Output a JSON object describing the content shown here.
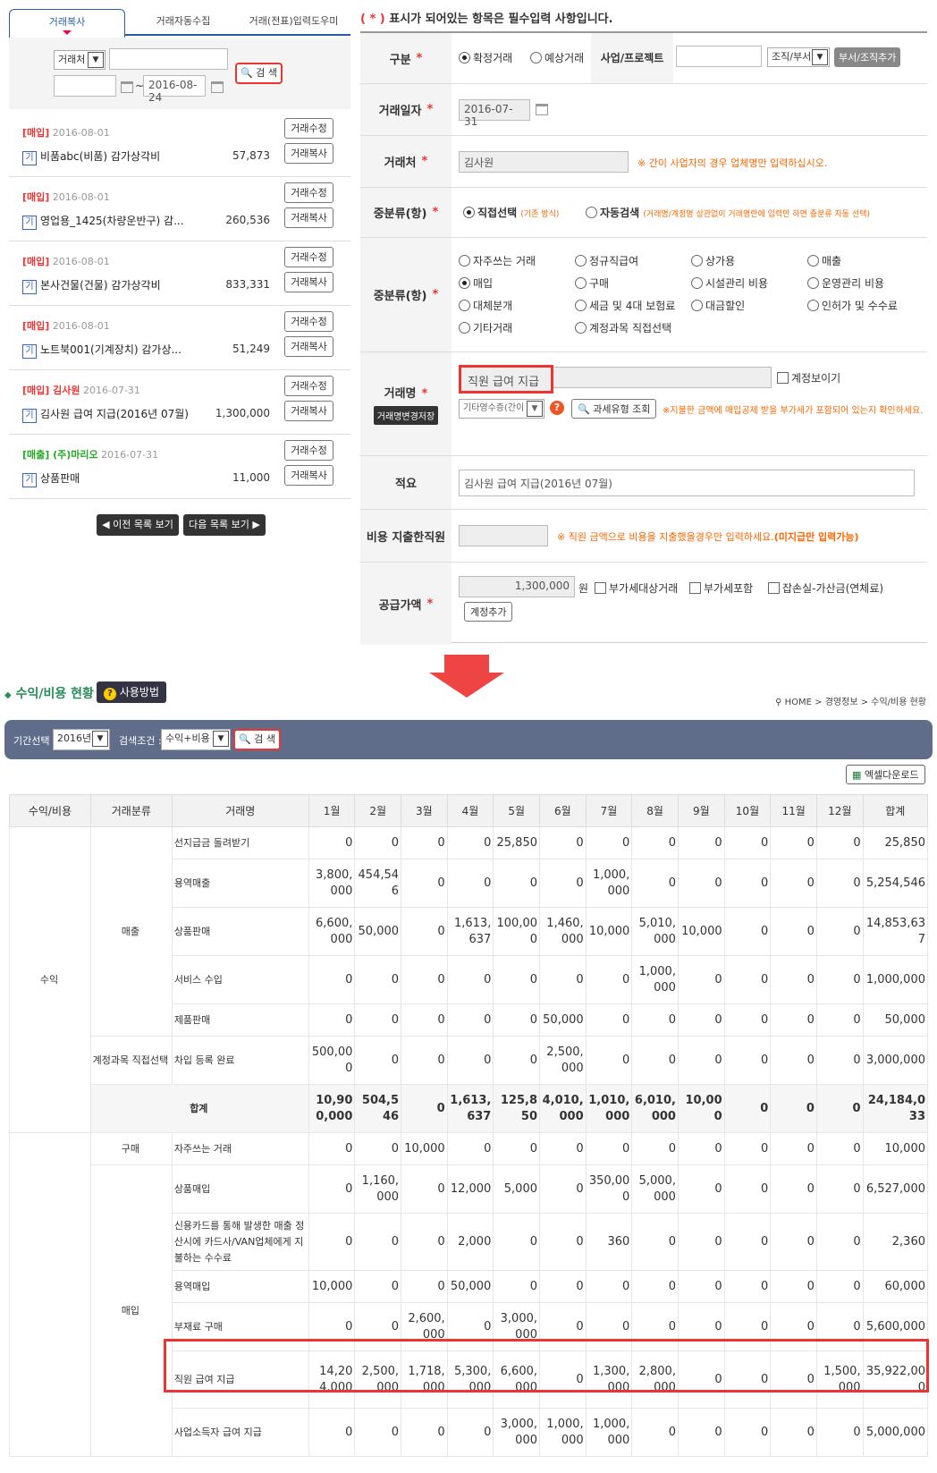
{
  "left": {
    "tabs": [
      "거래복사",
      "거래자동수집",
      "거래(전표)입력도우미"
    ],
    "search": {
      "type_value": "거래처",
      "keyword": "",
      "date_from": "",
      "date_sep": "~",
      "date_to": "2016-08-24",
      "button": "검 색"
    },
    "items": [
      {
        "tag": "[매입]",
        "date": "2016-08-01",
        "badge": "기",
        "name": "비품abc(비품) 감가상각비",
        "amount": "57,873"
      },
      {
        "tag": "[매입]",
        "date": "2016-08-01",
        "badge": "기",
        "name": "영업용_1425(차량운반구) 감...",
        "amount": "260,536"
      },
      {
        "tag": "[매입]",
        "date": "2016-08-01",
        "badge": "기",
        "name": "본사건물(건물) 감가상각비",
        "amount": "833,331"
      },
      {
        "tag": "[매입]",
        "date": "2016-08-01",
        "badge": "기",
        "name": "노트북001(기계장치) 감가상...",
        "amount": "51,249"
      },
      {
        "tag": "[매입] 김사원",
        "date": "2016-07-31",
        "badge": "기",
        "name": "김사원 급여 지급(2016년 07월)",
        "amount": "1,300,000"
      },
      {
        "tag": "[매출] (주)마리오",
        "date": "2016-07-31",
        "badge": "기",
        "name": "상품판매",
        "amount": "11,000"
      }
    ],
    "edit_label": "거래수정",
    "copy_label": "거래복사",
    "prev": "◀ 이전 목록 보기",
    "next": "다음 목록 보기 ▶"
  },
  "form": {
    "note": "표시가 되어있는 항목은 필수입력 사항입니다.",
    "note_star": "( * )",
    "labels": {
      "type": "구분",
      "date": "거래일자",
      "partner": "거래처",
      "mid1": "중분류(항)",
      "mid2": "중분류(항)",
      "name": "거래명",
      "summary": "적요",
      "employee": "비용 지출한직원",
      "supply": "공급가액"
    },
    "type_opts": [
      "확정거래",
      "예상거래"
    ],
    "project_label": "사업/프로젝트",
    "org_select": "조직/부서",
    "org_button": "부서/조직추가",
    "date_value": "2016-07-31",
    "partner_value": "김사원",
    "partner_note": "※ 간이 사업자의 경우 업체명만 입력하십시오.",
    "mid_direct": "직접선택",
    "mid_direct_note": "(기존 방식)",
    "mid_auto": "자동검색",
    "mid_auto_note": "(거래명/계정명 상관없이 거래명란에 입력만 하면 중분류 자동 선택)",
    "categories": [
      "자주쓰는 거래",
      "정규직급여",
      "상가용",
      "매출",
      "매입",
      "구매",
      "시설관리 비용",
      "운영관리 비용",
      "대체분개",
      "세금 및 4대 보험료",
      "대금할인",
      "인허가 및 수수료",
      "기타거래",
      "계정과목 직접선택"
    ],
    "name_value": "직원 급여 지급",
    "show_account": "계정보이기",
    "name_save_btn": "거래명변경저장",
    "receipt_select": "기타영수증(간이",
    "tax_btn": "과세유형 조회",
    "vat_note": "※지불한 금액에 매입공제 받을 부가세가 포함되어 있는지 확인하세요.",
    "summary_value": "김사원 급여 지급(2016년 07월)",
    "employee_note": "※ 직원 금액으로 비용을 지출했을경우만 입력하세요.",
    "employee_note2": "(미지급만 입력가능)",
    "supply_value": "1,300,000",
    "won": "원",
    "supply_checks": [
      "부가세대상거래",
      "부가세포함",
      "잡손실-가산금(연체료)"
    ],
    "add_account": "계정추가"
  },
  "report": {
    "title": "수익/비용 현황",
    "help": "사용방법",
    "breadcrumb": "HOME > 경영정보 > 수익/비용 현황",
    "period_label": "기간선택 :",
    "year": "2016년",
    "cond_label": "검색조건 :",
    "cond": "수익+비용",
    "search_btn": "검 색",
    "excel_btn": "엑셀다운로드",
    "headers": [
      "수익/비용",
      "거래분류",
      "거래명",
      "1월",
      "2월",
      "3월",
      "4월",
      "5월",
      "6월",
      "7월",
      "8월",
      "9월",
      "10월",
      "11월",
      "12월",
      "합계"
    ],
    "groups": {
      "income": "수익",
      "sales": "매출",
      "direct": "계정과목 직접선택",
      "total": "합계",
      "purchase_cls": "구매",
      "buy": "매입"
    },
    "rows": [
      {
        "name": "선지급금 돌려받기",
        "v": [
          "0",
          "0",
          "0",
          "0",
          "25,850",
          "0",
          "0",
          "0",
          "0",
          "0",
          "0",
          "0",
          "25,850"
        ]
      },
      {
        "name": "용역매출",
        "v": [
          "3,800,000",
          "454,546",
          "0",
          "0",
          "0",
          "0",
          "1,000,000",
          "0",
          "0",
          "0",
          "0",
          "0",
          "5,254,546"
        ]
      },
      {
        "name": "상품판매",
        "v": [
          "6,600,000",
          "50,000",
          "0",
          "1,613,637",
          "100,000",
          "1,460,000",
          "10,000",
          "5,010,000",
          "10,000",
          "0",
          "0",
          "0",
          "14,853,637"
        ]
      },
      {
        "name": "서비스 수입",
        "v": [
          "0",
          "0",
          "0",
          "0",
          "0",
          "0",
          "0",
          "1,000,000",
          "0",
          "0",
          "0",
          "0",
          "1,000,000"
        ]
      },
      {
        "name": "제품판매",
        "v": [
          "0",
          "0",
          "0",
          "0",
          "0",
          "50,000",
          "0",
          "0",
          "0",
          "0",
          "0",
          "0",
          "50,000"
        ]
      },
      {
        "name": "차입 등록 완료",
        "v": [
          "500,000",
          "0",
          "0",
          "0",
          "0",
          "2,500,000",
          "0",
          "0",
          "0",
          "0",
          "0",
          "0",
          "3,000,000"
        ]
      },
      {
        "name": "합계",
        "v": [
          "10,900,000",
          "504,546",
          "0",
          "1,613,637",
          "125,850",
          "4,010,000",
          "1,010,000",
          "6,010,000",
          "10,000",
          "0",
          "0",
          "0",
          "24,184,033"
        ]
      },
      {
        "name": "자주쓰는 거래",
        "v": [
          "0",
          "0",
          "10,000",
          "0",
          "0",
          "0",
          "0",
          "0",
          "0",
          "0",
          "0",
          "0",
          "10,000"
        ]
      },
      {
        "name": "상품매입",
        "v": [
          "0",
          "1,160,000",
          "0",
          "12,000",
          "5,000",
          "0",
          "350,000",
          "5,000,000",
          "0",
          "0",
          "0",
          "0",
          "6,527,000"
        ]
      },
      {
        "name": "신용카드를 통해 발생한 매출 정산시에 카드사/VAN업체에게 지불하는 수수료",
        "v": [
          "0",
          "0",
          "0",
          "2,000",
          "0",
          "0",
          "360",
          "0",
          "0",
          "0",
          "0",
          "0",
          "2,360"
        ]
      },
      {
        "name": "용역매입",
        "v": [
          "10,000",
          "0",
          "0",
          "50,000",
          "0",
          "0",
          "0",
          "0",
          "0",
          "0",
          "0",
          "0",
          "60,000"
        ]
      },
      {
        "name": "부재료 구매",
        "v": [
          "0",
          "0",
          "2,600,000",
          "0",
          "3,000,000",
          "0",
          "0",
          "0",
          "0",
          "0",
          "0",
          "0",
          "5,600,000"
        ]
      },
      {
        "name": "직원 급여 지급",
        "v": [
          "14,204,000",
          "2,500,000",
          "1,718,000",
          "5,300,000",
          "6,600,000",
          "0",
          "1,300,000",
          "2,800,000",
          "0",
          "0",
          "0",
          "1,500,000",
          "35,922,000"
        ]
      },
      {
        "name": "사업소득자 급여 지급",
        "v": [
          "0",
          "0",
          "0",
          "0",
          "3,000,000",
          "1,000,000",
          "1,000,000",
          "0",
          "0",
          "0",
          "0",
          "0",
          "5,000,000"
        ]
      }
    ]
  },
  "colors": {
    "accent": "#2a5ea8",
    "highlight": "#e33",
    "bar": "#5f6c8a"
  }
}
